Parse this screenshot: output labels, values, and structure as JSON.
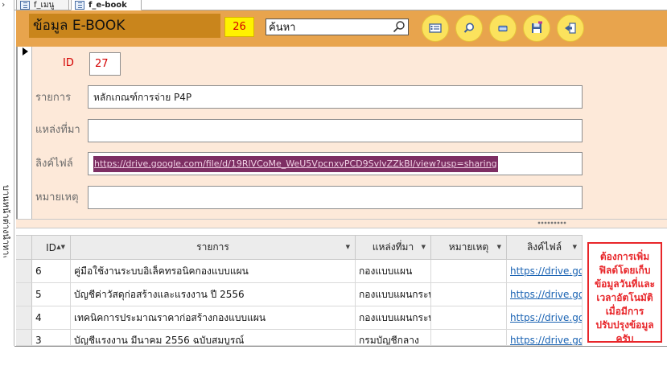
{
  "nav": {
    "label": "บานหน้าต่างนำทาง"
  },
  "tabs": [
    {
      "label": "f_เมนู",
      "active": false
    },
    {
      "label": "f_e-book",
      "active": true
    }
  ],
  "header": {
    "title": "ข้อมูล E-BOOK",
    "record_count": "26",
    "search_value": "ค้นหา",
    "buttons": [
      {
        "name": "form-view-button",
        "icon": "form-icon"
      },
      {
        "name": "find-button",
        "icon": "magnifier-icon"
      },
      {
        "name": "delete-button",
        "icon": "eraser-icon"
      },
      {
        "name": "save-button",
        "icon": "floppy-icon"
      },
      {
        "name": "exit-button",
        "icon": "exit-door-icon"
      }
    ]
  },
  "form": {
    "id_label": "ID",
    "id_value": "27",
    "item_label": "รายการ",
    "item_value": "หลักเกณฑ์การจ่าย P4P",
    "source_label": "แหล่งที่มา",
    "source_value": "",
    "link_label": "ลิงค์ไฟล์",
    "link_value": "https://drive.google.com/file/d/19RlVCoMe_WeU5VpcnxvPCD9SvlvZZkBI/view?usp=sharing",
    "note_label": "หมายเหตุ",
    "note_value": ""
  },
  "grid": {
    "columns": [
      "ID",
      "รายการ",
      "แหล่งที่มา",
      "หมายเหตุ",
      "ลิงค์ไฟล์"
    ],
    "rows": [
      {
        "id": "6",
        "item": "คู่มือใช้งานระบบอิเล็คทรอนิคกองแบบแผน",
        "source": "กองแบบแผน",
        "note": "",
        "link": "https://drive.go"
      },
      {
        "id": "5",
        "item": "บัญชีค่าวัสดุก่อสร้างและแรงงาน ปี 2556",
        "source": "กองแบบแผนกระท",
        "note": "",
        "link": "https://drive.go"
      },
      {
        "id": "4",
        "item": "เทคนิคการประมาณราคาก่อสร้างกองแบบแผน",
        "source": "กองแบบแผนกระท",
        "note": "",
        "link": "https://drive.go"
      },
      {
        "id": "3",
        "item": "บัญชีแรงงาน มีนาคม 2556 ฉบับสมบูรณ์",
        "source": "กรมบัญชีกลาง",
        "note": "",
        "link": "https://drive.go"
      }
    ]
  },
  "annotation": {
    "text": "ต้องการเพิ่มฟิลด์โดยเก็บข้อมูลวันที่และเวลาอัตโนมัติเมื่อมีการปรับปรุงข้อมูลครับ",
    "color": "#e8262a"
  }
}
